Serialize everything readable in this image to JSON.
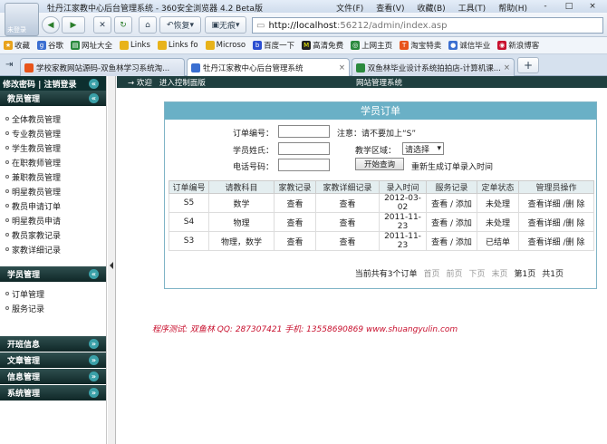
{
  "window": {
    "title": "牡丹江家教中心后台管理系统 - 360安全浏览器 4.2 Beta版",
    "avatar_label": "未登录",
    "menus": [
      "文件(F)",
      "查看(V)",
      "收藏(B)",
      "工具(T)",
      "帮助(H)"
    ],
    "controls": [
      "-",
      "□",
      "×"
    ]
  },
  "nav": {
    "restore": "恢复",
    "view": "无痕",
    "address_host": "http://localhost",
    "address_rest": ":56212/admin/index.asp"
  },
  "favorites": [
    {
      "label": "收藏",
      "color": "#e8a21a",
      "icon": "★"
    },
    {
      "label": "谷歌",
      "color": "#3b6fd1",
      "icon": "g"
    },
    {
      "label": "网址大全",
      "color": "#2b8a3e",
      "icon": "▤"
    },
    {
      "label": "Links",
      "color": "#e8b31a",
      "icon": ""
    },
    {
      "label": "Links fo",
      "color": "#e8b31a",
      "icon": ""
    },
    {
      "label": "Microso",
      "color": "#e8b31a",
      "icon": ""
    },
    {
      "label": "百度一下",
      "color": "#2b4ed1",
      "icon": "b"
    },
    {
      "label": "高清免费",
      "color": "#222",
      "icon": "M"
    },
    {
      "label": "上网主页",
      "color": "#2b8a3e",
      "icon": "◎"
    },
    {
      "label": "淘宝特卖",
      "color": "#e8541a",
      "icon": "T"
    },
    {
      "label": "诚信毕业",
      "color": "#3b6fd1",
      "icon": "●"
    },
    {
      "label": "新浪博客",
      "color": "#c8102e",
      "icon": "◉"
    }
  ],
  "tabs": [
    {
      "label": "学校家教网站源码-双鱼林学习系统淘...",
      "active": false
    },
    {
      "label": "牡丹江家教中心后台管理系统",
      "active": true
    },
    {
      "label": "双鱼林毕业设计系统拍拍店-计算机课...",
      "active": false
    }
  ],
  "sidebar": {
    "top": "修改密码 | 注销登录",
    "sections": [
      {
        "title": "教员管理",
        "items": [
          "全体教员管理",
          "专业教员管理",
          "学生教员管理",
          "在职教师管理",
          "兼职教员管理",
          "明星教员管理",
          "教员申请订单",
          "明星教员申请",
          "教员家教记录",
          "家教详细记录"
        ]
      },
      {
        "title": "学员管理",
        "items": [
          "订单管理",
          "服务记录"
        ]
      },
      {
        "title": "开班信息",
        "items": []
      },
      {
        "title": "文章管理",
        "items": []
      },
      {
        "title": "信息管理",
        "items": []
      },
      {
        "title": "系统管理",
        "items": []
      }
    ]
  },
  "main": {
    "topbar": {
      "welcome": "→ 欢迎",
      "enter": "进入控制面版",
      "sysname": "网站管理系统"
    },
    "panel_title": "学员订单",
    "form": {
      "order_no": "订单编号：",
      "note": "注意：请不要加上“S”",
      "student_name": "学员姓氏：",
      "region": "教学区域：",
      "region_value": "请选择",
      "phone": "电话号码：",
      "search_btn": "开始查询",
      "regen": "重新生成订单录入时间"
    },
    "columns": [
      "订单编号",
      "请教科目",
      "家教记录",
      "家教详细记录",
      "录入时间",
      "服务记录",
      "定单状态",
      "管理员操作"
    ],
    "rows": [
      {
        "id": "S5",
        "subject": "数学",
        "rec": "查看",
        "detail": "查看",
        "time": "2012-03-02",
        "svc": "查看 / 添加",
        "status": "未处理",
        "ops": "查看详细 /删 除"
      },
      {
        "id": "S4",
        "subject": "物理",
        "rec": "查看",
        "detail": "查看",
        "time": "2011-11-23",
        "svc": "查看 / 添加",
        "status": "未处理",
        "ops": "查看详细 /删 除"
      },
      {
        "id": "S3",
        "subject": "物理，数学",
        "rec": "查看",
        "detail": "查看",
        "time": "2011-11-23",
        "svc": "查看 / 添加",
        "status": "已结单",
        "ops": "查看详细 /删 除"
      }
    ],
    "pager": {
      "info": "当前共有3个订单",
      "first": "首页",
      "prev": "前页",
      "next": "下页",
      "last": "末页",
      "page": "第1页",
      "total": "共1页"
    },
    "signature": "程序测试: 双鱼林 QQ: 287307421 手机: 13558690869 www.shuangyulin.com"
  }
}
